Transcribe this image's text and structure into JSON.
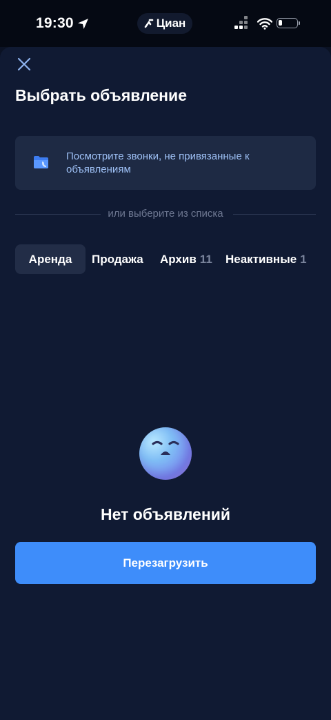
{
  "status_bar": {
    "time": "19:30",
    "app_pill": "Циан",
    "icons": [
      "location-arrow-icon",
      "cian-logo-icon",
      "cellular-signal-icon",
      "wifi-icon",
      "battery-icon"
    ]
  },
  "header": {
    "close_icon": "close-icon",
    "title": "Выбрать объявление"
  },
  "calls_card": {
    "icon": "folder-phone-icon",
    "text": "Посмотрите звонки, не привязанные к объявлениям"
  },
  "divider": {
    "text": "или выберите из списка"
  },
  "tabs": [
    {
      "label": "Аренда",
      "count": "",
      "active": true
    },
    {
      "label": "Продажа",
      "count": "",
      "active": false
    },
    {
      "label": "Архив",
      "count": "11",
      "active": false
    },
    {
      "label": "Неактивные",
      "count": "1",
      "active": false
    }
  ],
  "empty_state": {
    "icon": "sad-face-emoji-icon",
    "title": "Нет объявлений",
    "button_label": "Перезагрузить"
  },
  "colors": {
    "background": "#101a33",
    "card": "#1e2a44",
    "accent": "#3e8dfa",
    "link_text": "#9ec0f5",
    "muted_text": "#6e7892"
  }
}
